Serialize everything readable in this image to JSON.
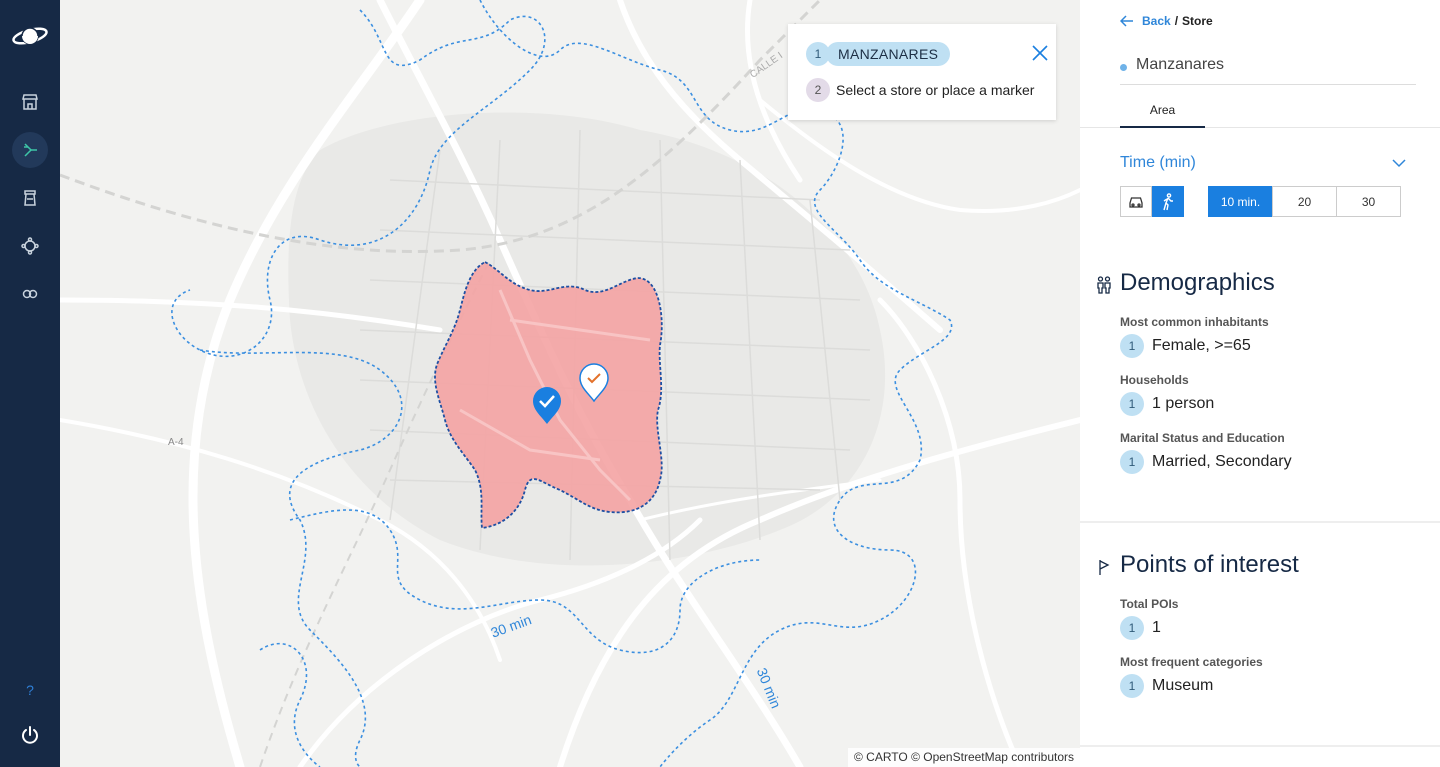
{
  "sidebar": {
    "logo_icon": "planet-logo-icon",
    "items": [
      {
        "name": "stores-icon"
      },
      {
        "name": "route-icon",
        "active": true
      },
      {
        "name": "tower-icon"
      },
      {
        "name": "network-icon"
      },
      {
        "name": "infinity-icon"
      }
    ],
    "help_label": "?",
    "power_icon": "power-icon"
  },
  "map": {
    "attribution": "© CARTO © OpenStreetMap contributors",
    "road_label_a4": "A-4",
    "road_label_calle": "CALLE I",
    "isochrone_label_1": "30 min",
    "isochrone_label_2": "30 min",
    "colors": {
      "area_fill": "#f4a3a3",
      "isochrone_line": "#3b8fe0",
      "marker": "#1a7fe0"
    }
  },
  "steps": {
    "step1_number": "1",
    "step1_label": "MANZANARES",
    "step2_number": "2",
    "step2_label": "Select a store or place a marker",
    "close_icon": "close-icon"
  },
  "panel": {
    "breadcrumb": {
      "back": "Back",
      "separator": "/",
      "current": "Store"
    },
    "store_name": "Manzanares",
    "tab_area": "Area",
    "time": {
      "label": "Time (min)",
      "modes": [
        "car-icon",
        "walk-icon"
      ],
      "active_mode": "walk-icon",
      "minutes": [
        "10 min.",
        "20",
        "30"
      ],
      "active_minute": "10 min."
    },
    "demographics": {
      "title": "Demographics",
      "icon": "people-icon",
      "stats": [
        {
          "label": "Most common inhabitants",
          "rank": "1",
          "value": "Female, >=65"
        },
        {
          "label": "Households",
          "rank": "1",
          "value": "1 person"
        },
        {
          "label": "Marital Status and Education",
          "rank": "1",
          "value": "Married, Secondary"
        }
      ]
    },
    "poi": {
      "title": "Points of interest",
      "icon": "flag-icon",
      "stats": [
        {
          "label": "Total POIs",
          "rank": "1",
          "value": "1"
        },
        {
          "label": "Most frequent categories",
          "rank": "1",
          "value": "Museum"
        }
      ]
    }
  }
}
